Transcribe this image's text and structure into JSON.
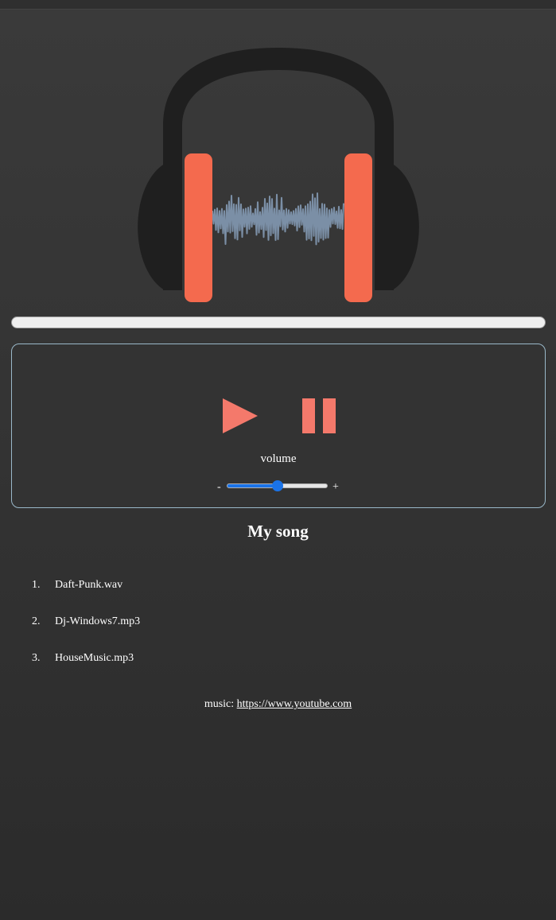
{
  "colors": {
    "accent": "#f46a4e",
    "button": "#f4796b",
    "headphone": "#1f1f1f",
    "wave": "#7b8fa6",
    "panel_border": "#9ab8c9",
    "slider": "#1a73e8"
  },
  "progress": {
    "value": 0
  },
  "controls": {
    "play_icon": "play-icon",
    "pause_icon": "pause-icon",
    "volume_label": "volume",
    "volume_minus": "-",
    "volume_plus": "+",
    "volume_value": 0.5
  },
  "playlist": {
    "title": "My song",
    "items": [
      {
        "num": "1.",
        "label": "Daft-Punk.wav"
      },
      {
        "num": "2.",
        "label": "Dj-Windows7.mp3"
      },
      {
        "num": "3.",
        "label": "HouseMusic.mp3"
      }
    ]
  },
  "footer": {
    "prefix": "music: ",
    "link_text": "https://www.youtube.com"
  }
}
